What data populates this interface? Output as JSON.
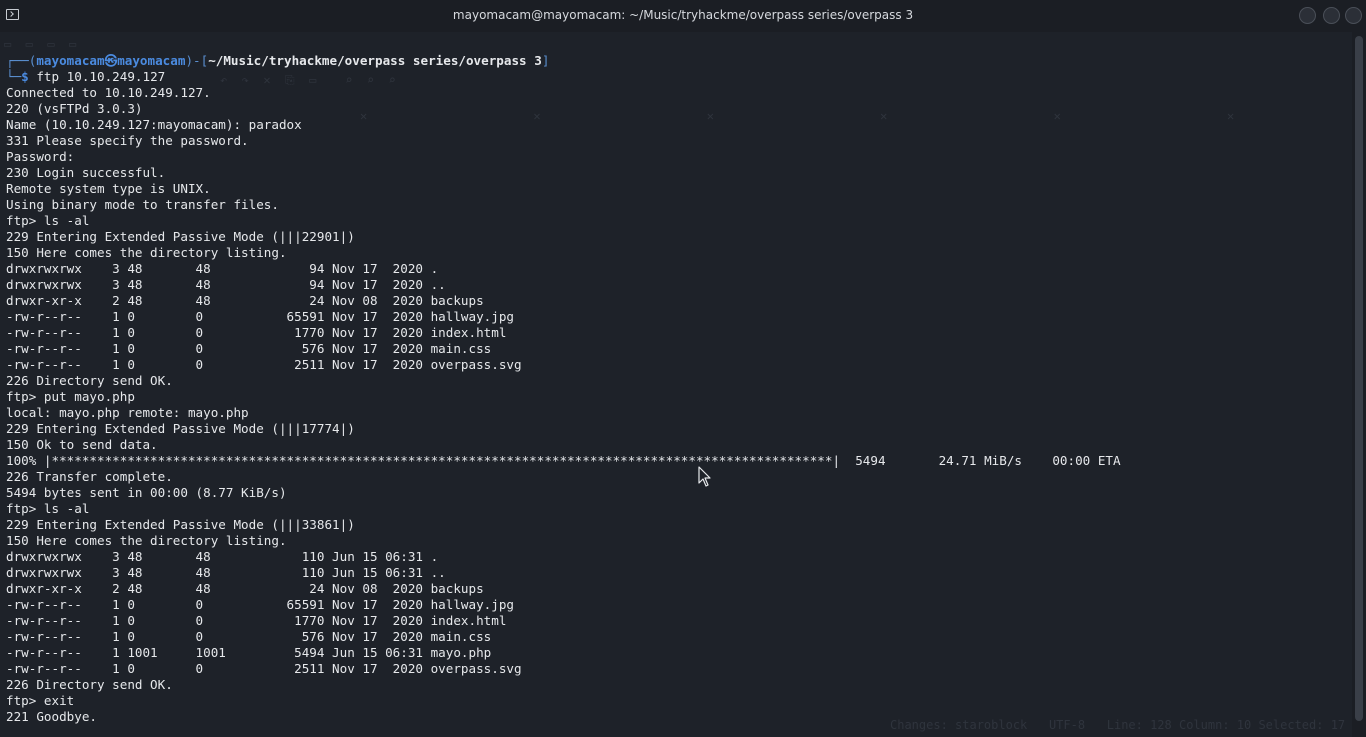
{
  "window": {
    "title": "mayomacam@mayomacam: ~/Music/tryhackme/overpass series/overpass 3"
  },
  "terminal": {
    "prompt_user": "mayomacam",
    "prompt_at": "㉿",
    "prompt_host": "mayomacam",
    "prompt_path": "~/Music/tryhackme/overpass series/overpass 3",
    "lines": [
      "ftp 10.10.249.127",
      "Connected to 10.10.249.127.",
      "220 (vsFTPd 3.0.3)",
      "Name (10.10.249.127:mayomacam): paradox",
      "331 Please specify the password.",
      "Password:",
      "230 Login successful.",
      "Remote system type is UNIX.",
      "Using binary mode to transfer files.",
      "ftp> ls -al",
      "229 Entering Extended Passive Mode (|||22901|)",
      "150 Here comes the directory listing.",
      "drwxrwxrwx    3 48       48             94 Nov 17  2020 .",
      "drwxrwxrwx    3 48       48             94 Nov 17  2020 ..",
      "drwxr-xr-x    2 48       48             24 Nov 08  2020 backups",
      "-rw-r--r--    1 0        0           65591 Nov 17  2020 hallway.jpg",
      "-rw-r--r--    1 0        0            1770 Nov 17  2020 index.html",
      "-rw-r--r--    1 0        0             576 Nov 17  2020 main.css",
      "-rw-r--r--    1 0        0            2511 Nov 17  2020 overpass.svg",
      "226 Directory send OK.",
      "ftp> put mayo.php",
      "local: mayo.php remote: mayo.php",
      "229 Entering Extended Passive Mode (|||17774|)",
      "150 Ok to send data.",
      "100% |*******************************************************************************************************|  5494       24.71 MiB/s    00:00 ETA",
      "226 Transfer complete.",
      "5494 bytes sent in 00:00 (8.77 KiB/s)",
      "ftp> ls -al",
      "229 Entering Extended Passive Mode (|||33861|)",
      "150 Here comes the directory listing.",
      "drwxrwxrwx    3 48       48            110 Jun 15 06:31 .",
      "drwxrwxrwx    3 48       48            110 Jun 15 06:31 ..",
      "drwxr-xr-x    2 48       48             24 Nov 08  2020 backups",
      "-rw-r--r--    1 0        0           65591 Nov 17  2020 hallway.jpg",
      "-rw-r--r--    1 0        0            1770 Nov 17  2020 index.html",
      "-rw-r--r--    1 0        0             576 Nov 17  2020 main.css",
      "-rw-r--r--    1 1001     1001         5494 Jun 15 06:31 mayo.php",
      "-rw-r--r--    1 0        0            2511 Nov 17  2020 overpass.svg",
      "226 Directory send OK.",
      "ftp> exit",
      "221 Goodbye."
    ]
  }
}
